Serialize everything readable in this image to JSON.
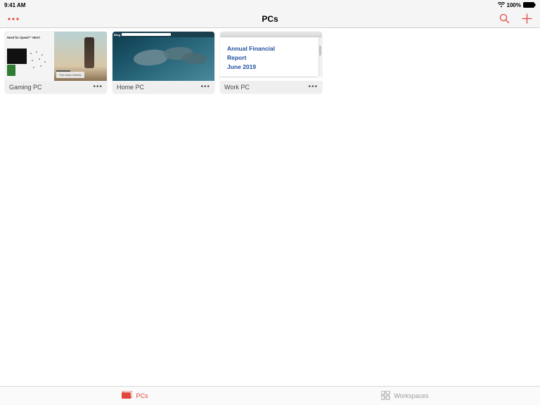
{
  "status": {
    "time": "9:41 AM",
    "battery": "100%"
  },
  "nav": {
    "title": "PCs"
  },
  "cards": [
    {
      "label": "Gaming PC",
      "thumb": {
        "nfs": "Need for Speed™ HEAT",
        "outer": "The Outer Worlds"
      }
    },
    {
      "label": "Home PC",
      "thumb": {
        "bing": "Bing"
      }
    },
    {
      "label": "Work PC",
      "thumb": {
        "line1": "Annual Financial",
        "line2": "Report",
        "line3": "June 2019"
      }
    }
  ],
  "tabs": {
    "pcs": "PCs",
    "workspaces": "Workspaces"
  }
}
